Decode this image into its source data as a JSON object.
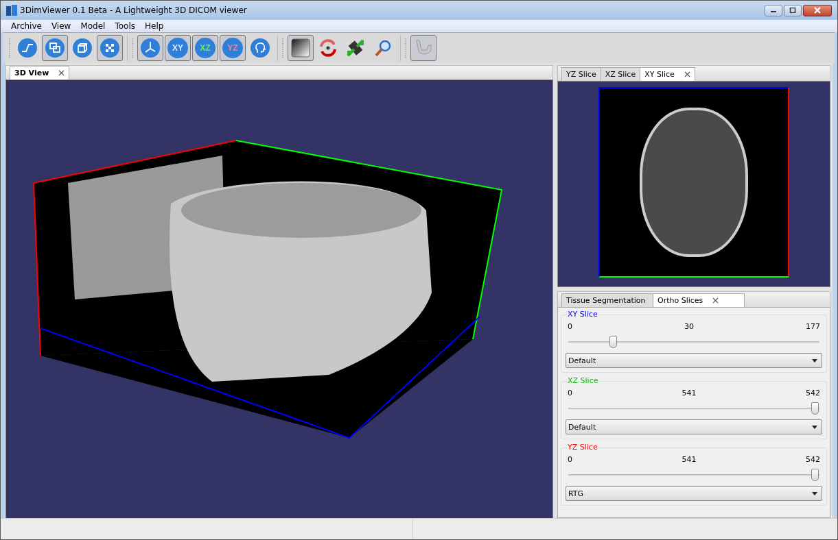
{
  "window": {
    "title": "3DimViewer 0.1 Beta - A Lightweight 3D DICOM viewer"
  },
  "menu": [
    "Archive",
    "View",
    "Model",
    "Tools",
    "Help"
  ],
  "toolbar": [
    {
      "kind": "curve",
      "selected": false
    },
    {
      "kind": "layout",
      "selected": true
    },
    {
      "kind": "cube",
      "selected": false
    },
    {
      "kind": "checker",
      "selected": true
    },
    {
      "kind": "sep"
    },
    {
      "kind": "axes",
      "selected": true
    },
    {
      "kind": "label",
      "text": "XY",
      "selected": true
    },
    {
      "kind": "label",
      "text": "XZ",
      "selected": true
    },
    {
      "kind": "label",
      "text": "YZ",
      "selected": true
    },
    {
      "kind": "head",
      "selected": false
    },
    {
      "kind": "sep"
    },
    {
      "kind": "gradient",
      "selected": true
    },
    {
      "kind": "rotate",
      "selected": false
    },
    {
      "kind": "resize",
      "selected": false
    },
    {
      "kind": "zoom",
      "selected": false
    },
    {
      "kind": "sep"
    },
    {
      "kind": "jaw",
      "selected": true
    }
  ],
  "view_tabs": [
    {
      "label": "3D View",
      "selected": true
    }
  ],
  "slice_tabs": [
    {
      "label": "YZ Slice",
      "selected": false
    },
    {
      "label": "XZ Slice",
      "selected": false
    },
    {
      "label": "XY Slice",
      "selected": true
    }
  ],
  "panel_tabs": [
    {
      "label": "Tissue Segmentation",
      "selected": false
    },
    {
      "label": "Ortho Slices",
      "selected": true
    }
  ],
  "slices": [
    {
      "title": "XY Slice",
      "color": "#0000ff",
      "min": "0",
      "value": "30",
      "max": "177",
      "level": 0.17,
      "preset": "Default"
    },
    {
      "title": "XZ Slice",
      "color": "#00c000",
      "min": "0",
      "value": "541",
      "max": "542",
      "level": 1.0,
      "preset": "Default"
    },
    {
      "title": "YZ Slice",
      "color": "#ff0000",
      "min": "0",
      "value": "541",
      "max": "542",
      "level": 1.0,
      "preset": "RTG"
    }
  ]
}
